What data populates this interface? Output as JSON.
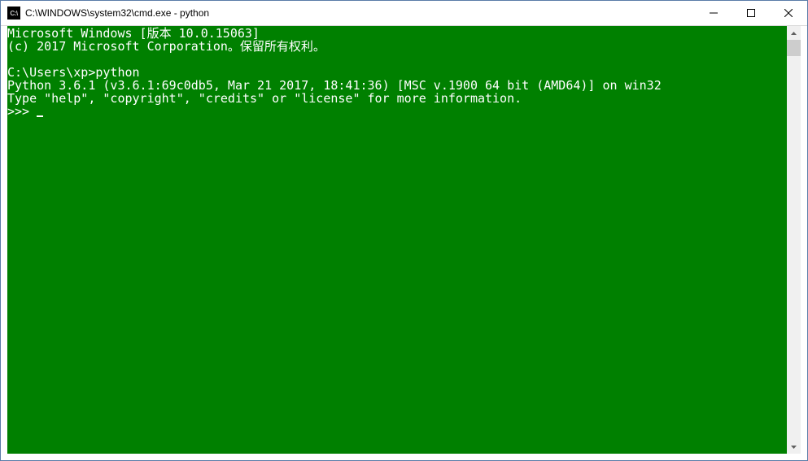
{
  "window": {
    "title": "C:\\WINDOWS\\system32\\cmd.exe - python",
    "icon_label": "C:\\"
  },
  "console": {
    "line1": "Microsoft Windows [版本 10.0.15063]",
    "line2": "(c) 2017 Microsoft Corporation。保留所有权利。",
    "blank1": "",
    "prompt1": "C:\\Users\\xp>python",
    "py_version": "Python 3.6.1 (v3.6.1:69c0db5, Mar 21 2017, 18:41:36) [MSC v.1900 64 bit (AMD64)] on win32",
    "py_help": "Type \"help\", \"copyright\", \"credits\" or \"license\" for more information.",
    "repl_prompt": ">>> "
  }
}
